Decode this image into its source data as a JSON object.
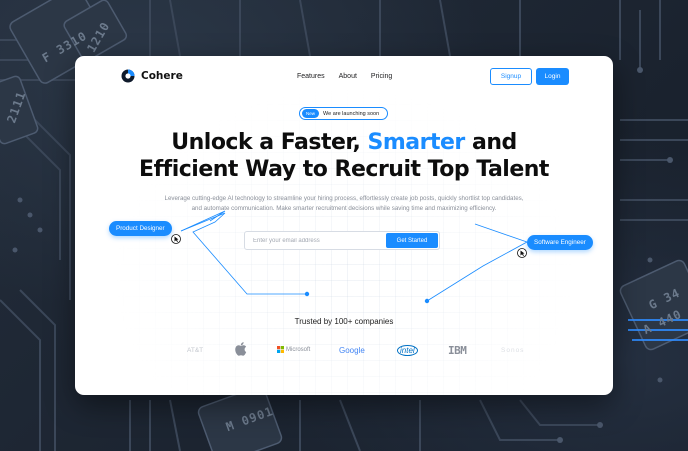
{
  "brand": {
    "name": "Cohere",
    "accent": "#1a8cff"
  },
  "nav": {
    "links": [
      "Features",
      "About",
      "Pricing"
    ],
    "signup_label": "Signup",
    "login_label": "Login"
  },
  "badge": {
    "pill": "New",
    "text": "We are launching soon"
  },
  "hero": {
    "title_part1": "Unlock a Faster,",
    "title_accent": "Smarter",
    "title_part2": "and",
    "title_line2": "Efficient Way to Recruit Top Talent",
    "subtitle": "Leverage cutting-edge AI technology to streamline your hiring process, effortlessly create job posts, quickly shortlist top candidates, and automate communication. Make smarter recruitment decisions while saving time and maximizing efficiency."
  },
  "form": {
    "email_placeholder": "Enter your email address",
    "email_value": "",
    "cta_label": "Get Started"
  },
  "tags": {
    "left": "Product Designer",
    "right": "Software Engineer"
  },
  "trusted": {
    "label": "Trusted by 100+ companies",
    "companies": [
      "AT&T",
      "Apple",
      "Microsoft",
      "Google",
      "intel",
      "IBM",
      "Sonos"
    ]
  },
  "background": {
    "chip_labels": [
      "F 3310",
      "1210",
      "G 34",
      "A 440",
      "M 0901",
      "2111"
    ]
  }
}
